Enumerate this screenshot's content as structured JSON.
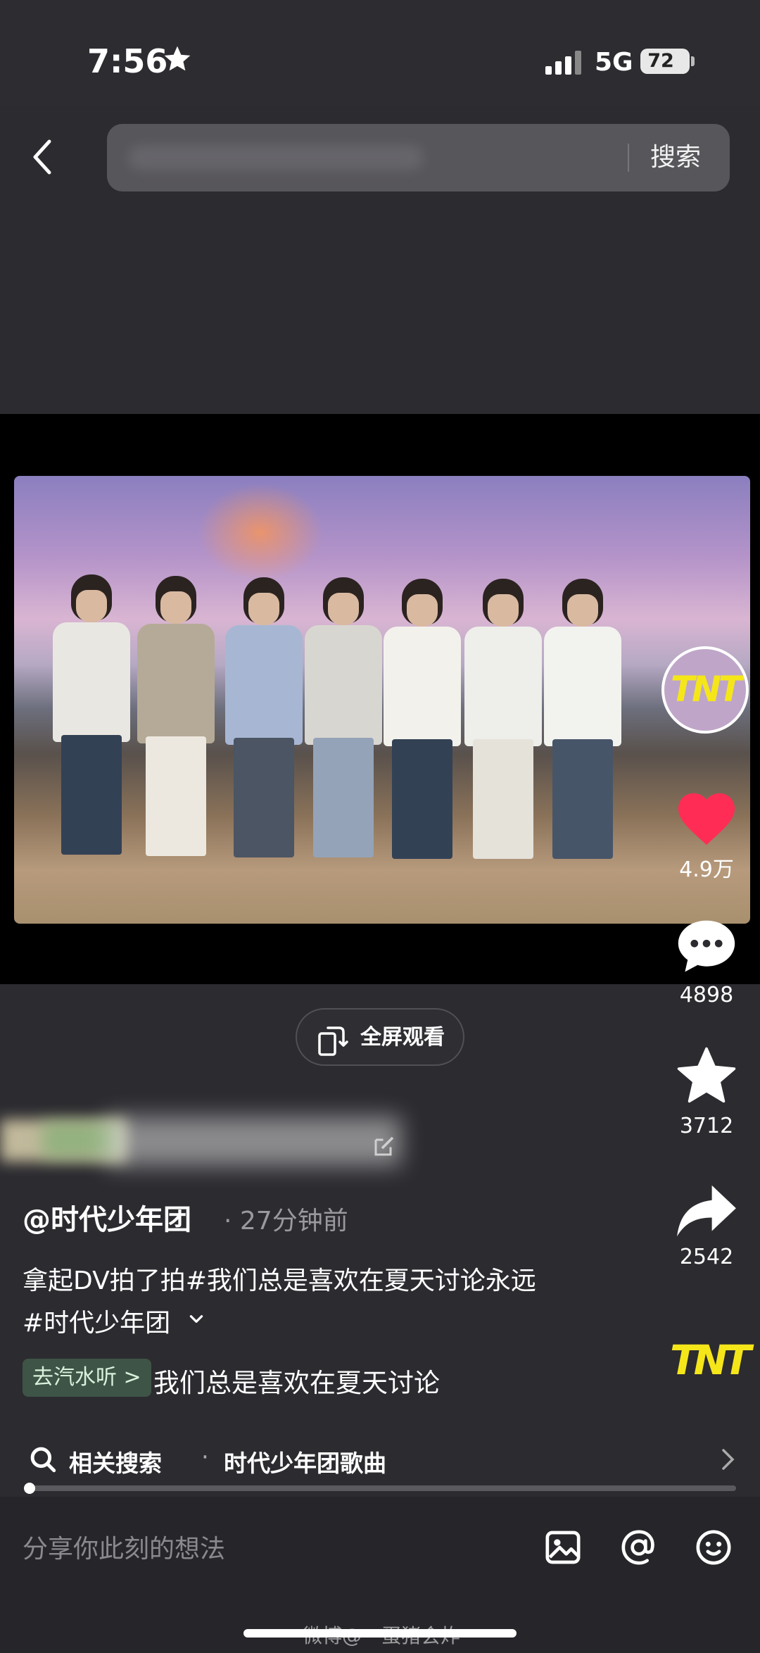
{
  "status_bar": {
    "time": "7:56",
    "network": "5G",
    "battery": "72"
  },
  "header": {
    "search_button": "搜索"
  },
  "actions": {
    "likes": "4.9万",
    "comments": "4898",
    "favorites": "3712",
    "shares": "2542"
  },
  "fullscreen_label": "全屏观看",
  "post": {
    "username": "@时代少年团",
    "time": "· 27分钟前",
    "caption_line1": "拿起DV拍了拍#我们总是喜欢在夏天讨论永远",
    "caption_line2": "#时代少年团",
    "music_tag": "去汽水听 >",
    "music_title": "我们总是喜欢在夏天讨论"
  },
  "related": {
    "label": "相关搜索",
    "separator": "·",
    "topic": "时代少年团歌曲"
  },
  "comment_placeholder": "分享你此刻的想法",
  "brand_logo": "TNT",
  "watermark": "微博@一蛋猪会炸一",
  "colors": {
    "like": "#ff2d55",
    "logo": "#f5e61a",
    "music_tag_bg": "#3e5446"
  }
}
